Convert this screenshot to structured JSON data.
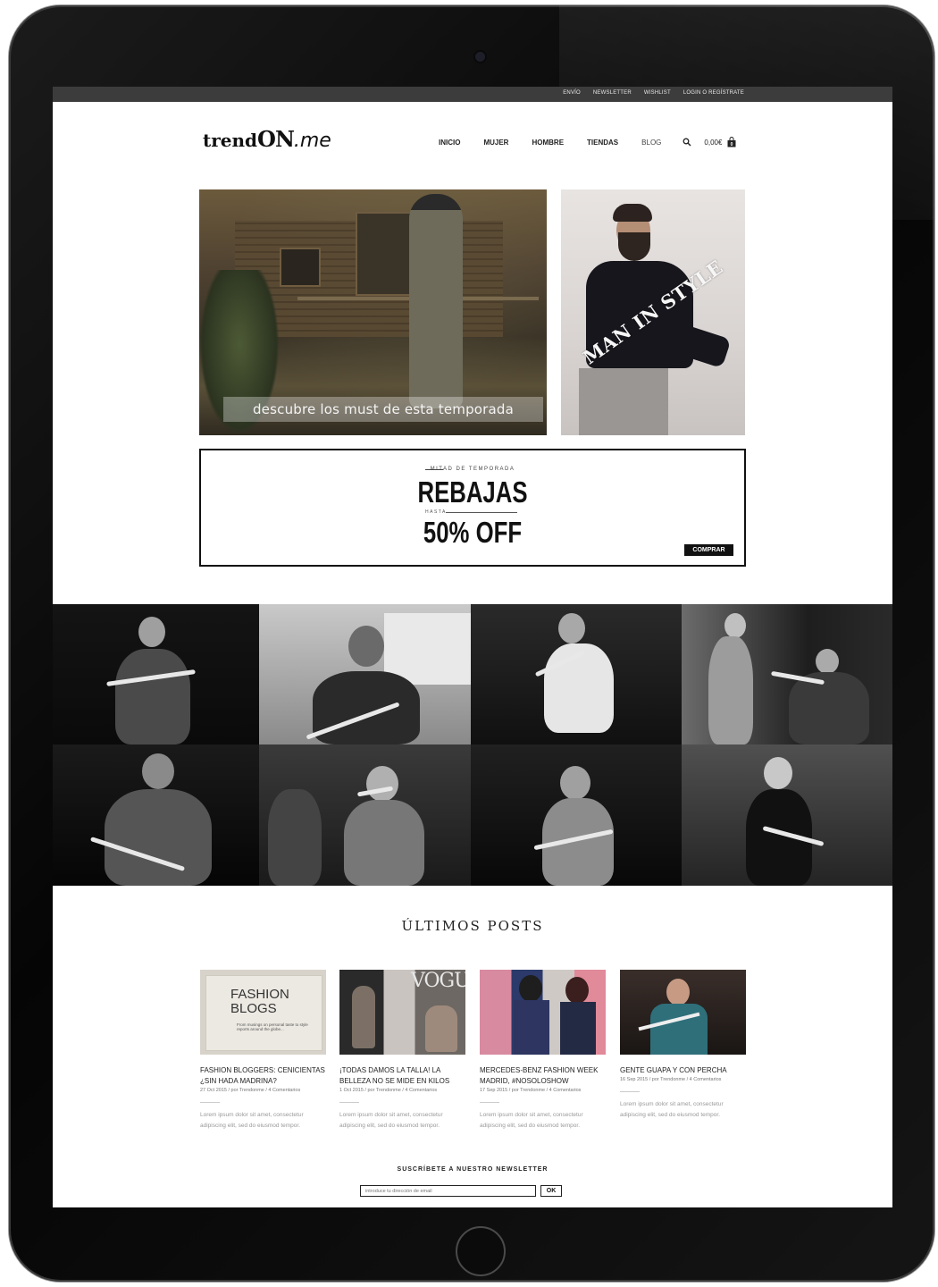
{
  "topbar": {
    "links": [
      "ENVÍO",
      "NEWSLETTER",
      "WISHLIST",
      "LOGIN O REGÍSTRATE"
    ]
  },
  "header": {
    "logo_part1": "trend",
    "logo_part2": "ON",
    "logo_part3": ".me",
    "nav": [
      "INICIO",
      "MUJER",
      "HOMBRE",
      "TIENDAS",
      "BLOG"
    ],
    "cart_total": "0,00€",
    "cart_count": "0",
    "icons": {
      "search": "search-icon",
      "cart": "shopping-bag-icon"
    }
  },
  "hero": {
    "left_caption": "descubre los must de esta temporada",
    "right_text": "MAN IN STYLE"
  },
  "promo": {
    "subtitle": "MITAD DE TEMPORADA",
    "title": "REBAJAS",
    "hasta": "HASTA",
    "value": "50% OFF",
    "button": "COMPRAR"
  },
  "posts": {
    "section_title": "ÚLTIMOS POSTS",
    "items": [
      {
        "thumb_title1": "FASHION",
        "thumb_title2": "BLOGS",
        "thumb_small": "From musings on personal taste to style reports around the globe...",
        "title": "FASHION BLOGGERS: CENICIENTAS ¿SIN HADA MADRINA?",
        "meta": "27 Oct 2015  /  por Trendonme  /  4 Comentarios",
        "excerpt": "Lorem ipsum dolor sit amet, consectetur adipiscing elit, sed do eiusmod tempor."
      },
      {
        "thumb_title1": "VOGUE",
        "title": "¡TODAS DAMOS LA TALLA! LA BELLEZA NO SE MIDE EN KILOS",
        "meta": "1 Oct 2015  /  por Trendonme  /  4 Comentarios",
        "excerpt": "Lorem ipsum dolor sit amet, consectetur adipiscing elit, sed do eiusmod tempor."
      },
      {
        "title": "MERCEDES-BENZ FASHION WEEK MADRID, #NOSOLOSHOW",
        "meta": "17 Sep 2015  /  por Trendonme  /  4 Comentarios",
        "excerpt": "Lorem ipsum dolor sit amet, consectetur adipiscing elit, sed do eiusmod tempor."
      },
      {
        "title": "GENTE GUAPA Y CON PERCHA",
        "meta": "16 Sep 2015  /  por Trendonme  /  4 Comentarios",
        "excerpt": "Lorem ipsum dolor sit amet, consectetur adipiscing elit, sed do eiusmod tempor."
      }
    ]
  },
  "newsletter": {
    "title": "SUSCRÍBETE A NUESTRO NEWSLETTER",
    "placeholder": "introduce tu dirección de email",
    "button": "OK"
  }
}
